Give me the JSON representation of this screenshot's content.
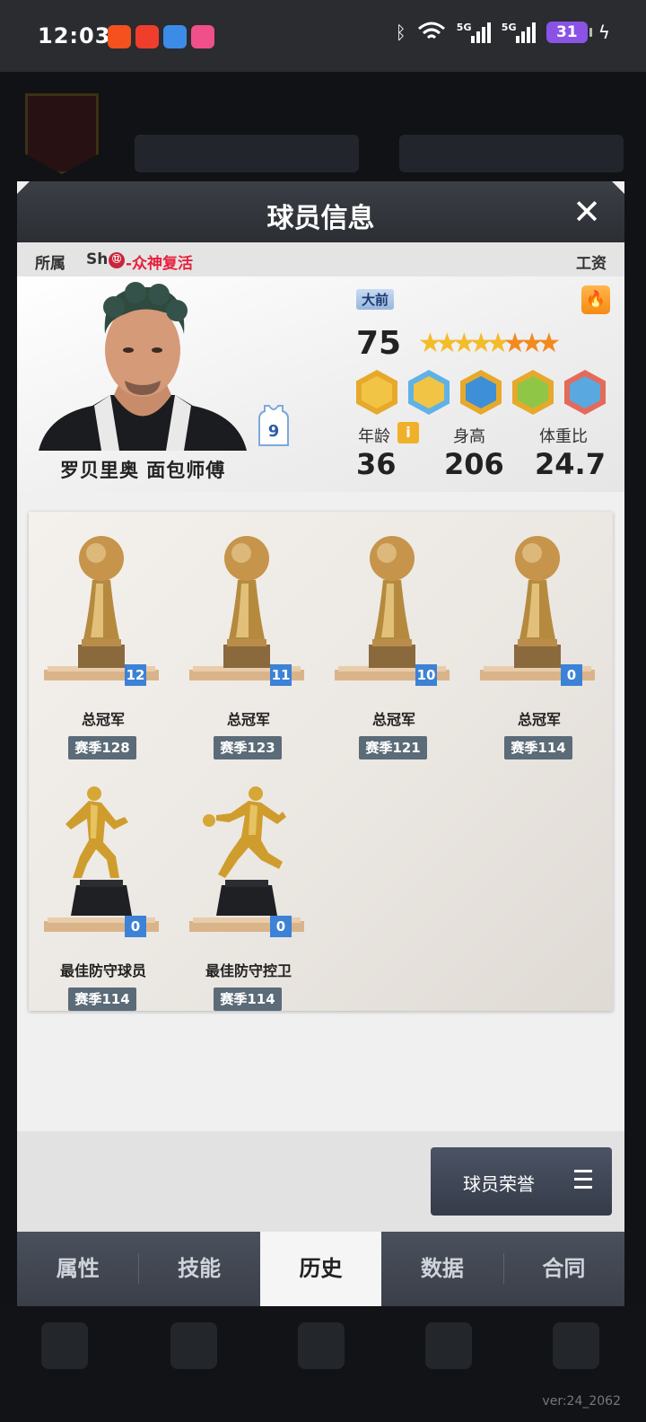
{
  "status_bar": {
    "time": "12:03",
    "signal1": "5G",
    "signal2": "5G",
    "battery": "31",
    "app_icons": [
      "app-icon-1",
      "app-icon-2",
      "app-icon-3",
      "app-icon-4"
    ]
  },
  "modal": {
    "title": "球员信息",
    "close": "✕"
  },
  "team": {
    "belong_label": "所属",
    "prefix": "Sh",
    "badge": "⑫",
    "name": "-众神复活",
    "salary_label": "工资"
  },
  "player": {
    "name": "罗贝里奥 面包师傅",
    "jersey_number": "9",
    "position": "大前",
    "rating": "75",
    "stars": {
      "gold": 5,
      "orange": 3
    },
    "age_label": "年龄",
    "age": "36",
    "height_label": "身高",
    "height": "206",
    "weight_label": "体重比",
    "weight": "24.7",
    "info_icon": "i",
    "fire_icon": "fire-icon",
    "skill_icons": [
      "post-skill-icon",
      "block-skill-icon",
      "speed-skill-icon",
      "sneaker-skill-icon",
      "defense-skill-icon"
    ]
  },
  "trophies": [
    {
      "name": "总冠军",
      "season": "赛季128",
      "count": "12",
      "type": "championship"
    },
    {
      "name": "总冠军",
      "season": "赛季123",
      "count": "11",
      "type": "championship"
    },
    {
      "name": "总冠军",
      "season": "赛季121",
      "count": "10",
      "type": "championship"
    },
    {
      "name": "总冠军",
      "season": "赛季114",
      "count": "0",
      "type": "championship"
    },
    {
      "name": "最佳防守球员",
      "season": "赛季114",
      "count": "0",
      "type": "dpoy"
    },
    {
      "name": "最佳防守控卫",
      "season": "赛季114",
      "count": "0",
      "type": "dpg"
    }
  ],
  "honor_button": "球员荣誉",
  "tabs": [
    {
      "label": "属性",
      "active": false
    },
    {
      "label": "技能",
      "active": false
    },
    {
      "label": "历史",
      "active": true
    },
    {
      "label": "数据",
      "active": false
    },
    {
      "label": "合同",
      "active": false
    }
  ],
  "version": "ver:24_2062",
  "colors": {
    "team_name": "#e8213d",
    "count_badge": "#3c82d6",
    "season_tag": "#5b6b78",
    "star_gold": "#f3bc2a",
    "star_orange": "#f28a20"
  }
}
